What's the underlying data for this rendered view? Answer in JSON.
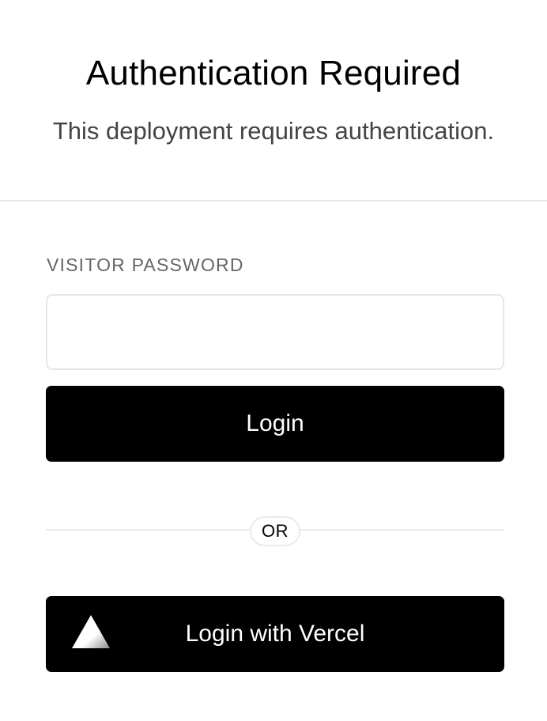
{
  "header": {
    "title": "Authentication Required",
    "subtitle": "This deployment requires authentication."
  },
  "form": {
    "password_label": "VISITOR PASSWORD",
    "password_value": "",
    "password_placeholder": "",
    "login_button": "Login"
  },
  "divider": {
    "or_text": "OR"
  },
  "vercel": {
    "button_label": "Login with Vercel",
    "logo_icon": "vercel-triangle-icon"
  },
  "colors": {
    "background": "#ffffff",
    "button": "#000000",
    "button_text": "#ffffff",
    "label_text": "#666666",
    "divider": "#eaeaea"
  }
}
